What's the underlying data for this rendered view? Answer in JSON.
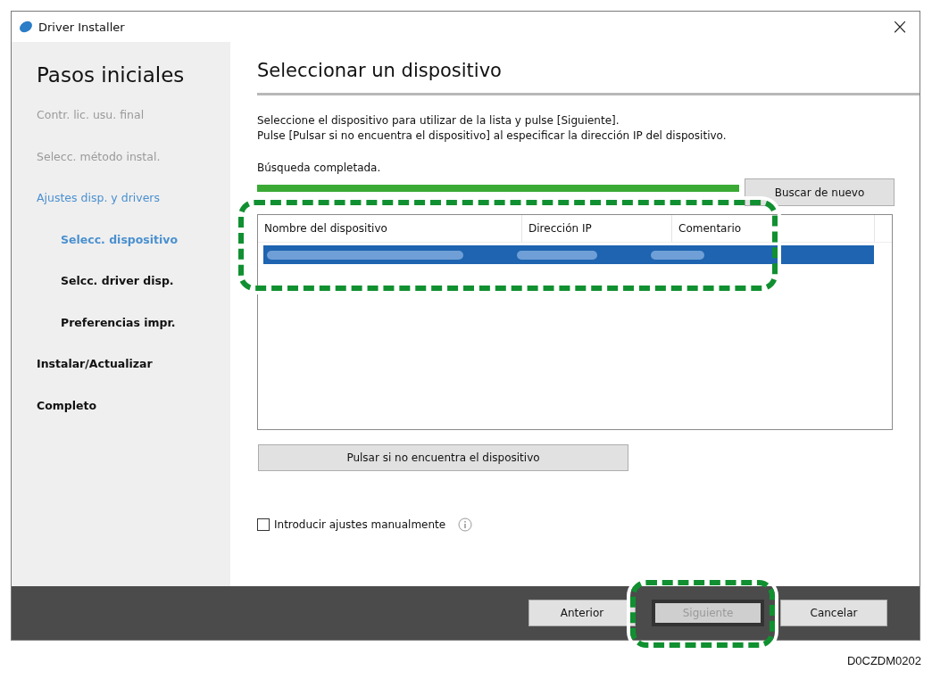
{
  "window": {
    "title": "Driver Installer",
    "close": "×"
  },
  "sidebar": {
    "title": "Pasos iniciales",
    "steps": [
      {
        "label": "Contr. lic. usu. final",
        "kind": "done"
      },
      {
        "label": "Selecc. método instal.",
        "kind": "done"
      },
      {
        "label": "Ajustes disp. y drivers",
        "kind": "current",
        "children": [
          {
            "label": "Selecc. dispositivo",
            "kind": "current"
          },
          {
            "label": "Selcc. driver disp.",
            "kind": "pending"
          },
          {
            "label": "Preferencias impr.",
            "kind": "pending"
          }
        ]
      },
      {
        "label": "Instalar/Actualizar",
        "kind": "pending"
      },
      {
        "label": "Completo",
        "kind": "pending"
      }
    ]
  },
  "main": {
    "heading": "Seleccionar un dispositivo",
    "instructions": [
      "Seleccione el dispositivo para utilizar de la lista y pulse [Siguiente].",
      "Pulse [Pulsar si no encuentra el dispositivo] al especificar la dirección IP del dispositivo."
    ],
    "status": "Búsqueda completada.",
    "progress": {
      "level": 1
    },
    "search_again_button": "Buscar de nuevo",
    "table": {
      "columns": [
        "Nombre del dispositivo",
        "Dirección IP",
        "Comentario"
      ],
      "rows": [
        {
          "selected": true
        }
      ]
    },
    "not_found_button": "Pulsar si no encuentra el dispositivo",
    "manual_checkbox": {
      "label": "Introducir ajustes manualmente",
      "checked": false
    }
  },
  "footer": {
    "buttons": [
      {
        "label": "Anterior",
        "disabled": false,
        "focused": false
      },
      {
        "label": "Siguiente",
        "disabled": true,
        "focused": true
      },
      {
        "label": "Cancelar",
        "disabled": false,
        "focused": false
      }
    ]
  },
  "caption": "D0CZDM0202"
}
